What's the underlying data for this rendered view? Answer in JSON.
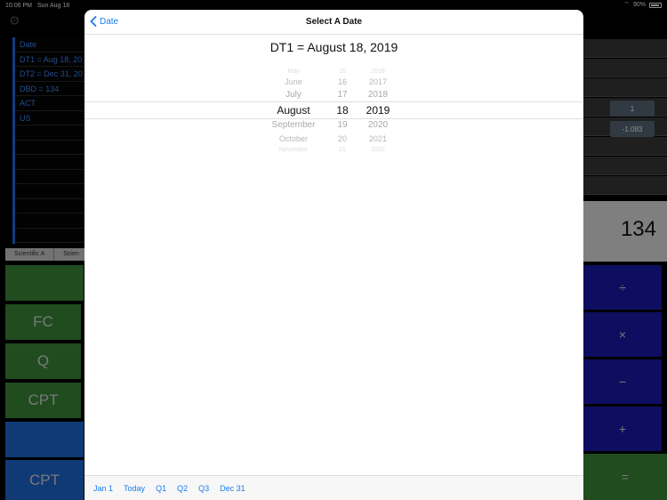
{
  "status_bar": {
    "time": "10:06 PM",
    "date": "Sun Aug 18",
    "battery": "90%"
  },
  "registers": [
    "Date",
    "DT1 = Aug 18, 20",
    "DT2 = Dec 31, 20",
    "DBD = 134",
    "ACT",
    "US",
    "",
    "",
    "",
    "",
    "",
    "",
    "",
    ""
  ],
  "tabs": [
    "Scientific A",
    "Scien"
  ],
  "left_keys": {
    "fc": "FC",
    "q": "Q",
    "cpt1": "CPT",
    "cpt2": "CPT"
  },
  "right_ops": {
    "divide": "÷",
    "multiply": "×",
    "minus": "−",
    "plus": "+",
    "equals": "="
  },
  "right_values": {
    "v1": "1",
    "v2": "-1.083",
    "display": "134"
  },
  "modal": {
    "back_label": "Date",
    "title": "Select A Date",
    "dt_label": "DT1 = August 18, 2019",
    "months": [
      "May",
      "June",
      "July",
      "August",
      "September",
      "October",
      "November"
    ],
    "days": [
      "15",
      "16",
      "17",
      "18",
      "19",
      "20",
      "21"
    ],
    "years": [
      "2016",
      "2017",
      "2018",
      "2019",
      "2020",
      "2021",
      "2022"
    ],
    "selected_index": 3,
    "footer": [
      "Jan 1",
      "Today",
      "Q1",
      "Q2",
      "Q3",
      "Dec 31"
    ]
  },
  "colors": {
    "accent": "#1a7cf0",
    "green_key": "#3b8a3a",
    "blue_key": "#1d6bd8",
    "navy_key": "#1a1ab0"
  }
}
